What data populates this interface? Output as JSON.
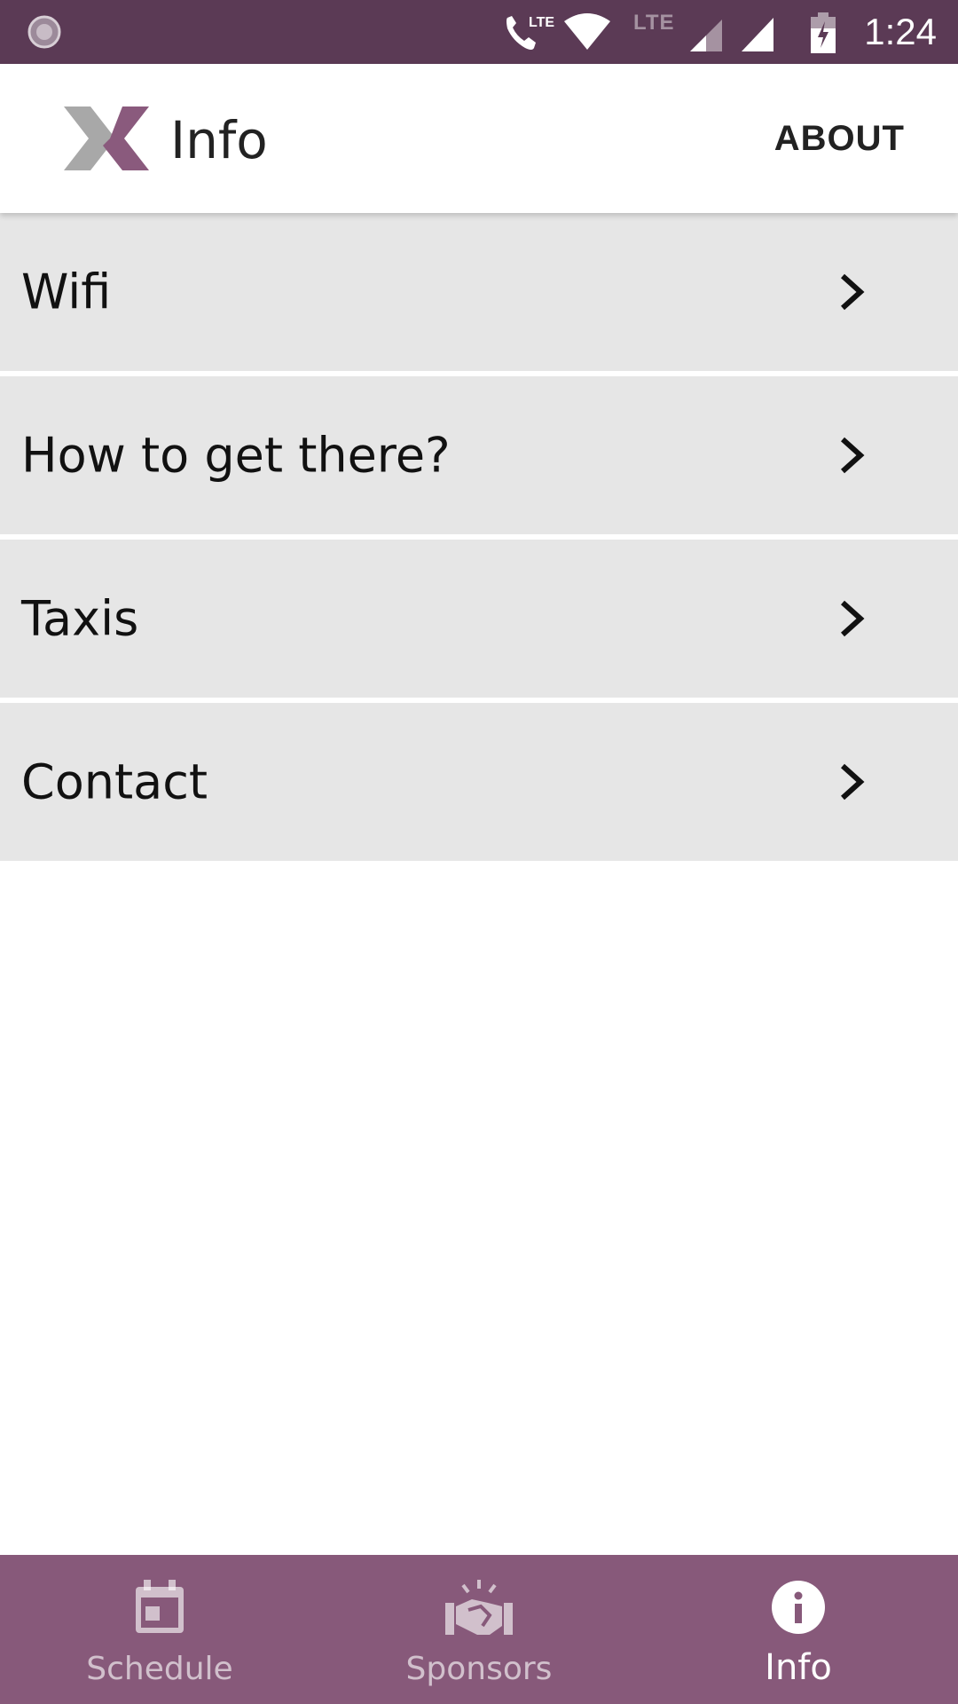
{
  "status_bar": {
    "time": "1:24",
    "lte_label": "LTE",
    "icons": [
      "app-notification-icon",
      "lte-call-icon",
      "wifi-icon",
      "signal-icon",
      "battery-charging-icon"
    ]
  },
  "app_bar": {
    "title": "Info",
    "about_label": "ABOUT",
    "logo_icon": "x-logo-icon"
  },
  "list": {
    "items": [
      {
        "label": "Wifi",
        "icon": "chevron-right-icon"
      },
      {
        "label": "How to get there?",
        "icon": "chevron-right-icon"
      },
      {
        "label": "Taxis",
        "icon": "chevron-right-icon"
      },
      {
        "label": "Contact",
        "icon": "chevron-right-icon"
      }
    ]
  },
  "bottom_nav": {
    "items": [
      {
        "label": "Schedule",
        "icon": "calendar-icon",
        "active": false
      },
      {
        "label": "Sponsors",
        "icon": "handshake-icon",
        "active": false
      },
      {
        "label": "Info",
        "icon": "info-icon",
        "active": true
      }
    ]
  },
  "colors": {
    "status_bar": "#5b3a55",
    "bottom_nav": "#87597a",
    "list_item_bg": "#e6e6e6",
    "logo_accent": "#8a5a7d",
    "logo_grey": "#a8a8a8"
  }
}
